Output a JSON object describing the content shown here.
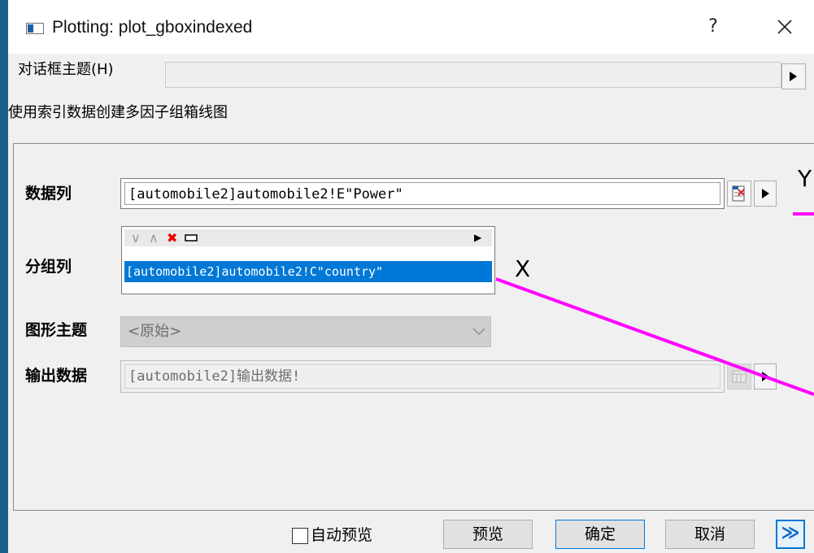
{
  "window": {
    "title": "Plotting: plot_gboxindexed",
    "help": "?"
  },
  "dialog_theme": {
    "label": "对话框主题(H)",
    "value": ""
  },
  "description": "使用索引数据创建多因子组箱线图",
  "fields": {
    "data_column": {
      "label": "数据列",
      "value": "[automobile2]automobile2!E\"Power\""
    },
    "group_column": {
      "label": "分组列",
      "items": [
        "[automobile2]automobile2!C\"country\""
      ]
    },
    "graph_theme": {
      "label": "图形主题",
      "value": "<原始>"
    },
    "output_data": {
      "label": "输出数据",
      "value": "[automobile2]输出数据!"
    }
  },
  "annotations": {
    "x_label": "X",
    "y_label": "Y",
    "color": "#ff00ff"
  },
  "footer": {
    "auto_preview_label": "自动预览",
    "auto_preview_checked": false,
    "preview_button": "预览",
    "ok_button": "确定",
    "cancel_button": "取消",
    "expand_button": "≫"
  },
  "colors": {
    "desktop": "#1a5f86",
    "selection": "#0078d7",
    "accent": "#0078d7"
  }
}
